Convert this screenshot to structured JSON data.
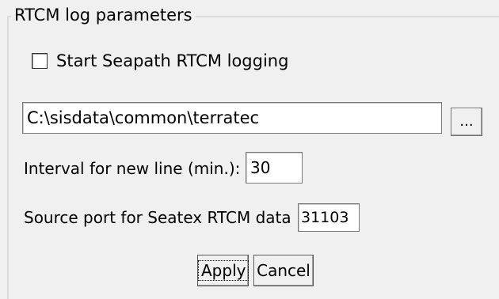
{
  "group": {
    "title": "RTCM log parameters"
  },
  "logging_checkbox": {
    "label": "Start Seapath RTCM logging",
    "checked": false
  },
  "path_field": {
    "value": "C:\\sisdata\\common\\terratec"
  },
  "browse_button": {
    "label": "..."
  },
  "interval": {
    "label": "Interval for new line (min.):",
    "value": "30"
  },
  "source_port": {
    "label": "Source port for Seatex RTCM data",
    "value": "31103"
  },
  "buttons": {
    "apply_label": "Apply",
    "cancel_label": "Cancel"
  }
}
